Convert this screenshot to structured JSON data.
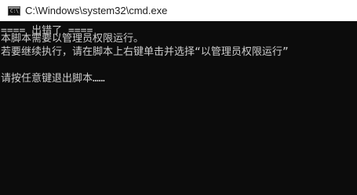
{
  "window": {
    "title": "C:\\Windows\\system32\\cmd.exe",
    "icon": "cmd-icon"
  },
  "console": {
    "lines": [
      "==== 出错了 ====",
      "本脚本需要以管理员权限运行。",
      "若要继续执行，请在脚本上右键单击并选择“以管理员权限运行”",
      "",
      "请按任意键退出脚本……"
    ]
  },
  "colors": {
    "background": "#0c0c0c",
    "text": "#cccccc",
    "titlebar": "#ffffff"
  }
}
